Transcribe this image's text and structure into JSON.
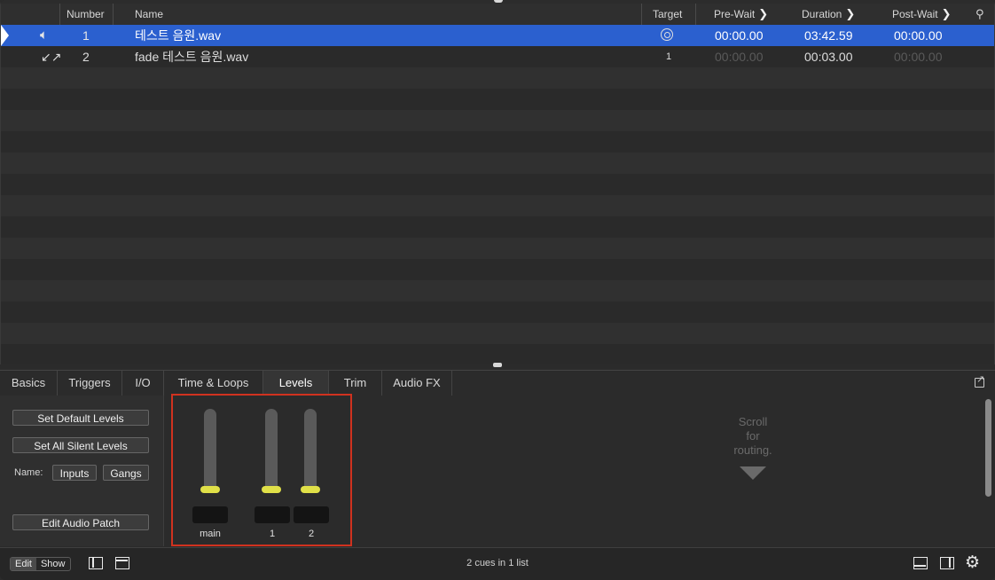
{
  "cuelist": {
    "headers": {
      "number": "Number",
      "name": "Name",
      "target": "Target",
      "prewait": "Pre-Wait",
      "duration": "Duration",
      "postwait": "Post-Wait"
    },
    "rows": [
      {
        "type": "audio",
        "number": "1",
        "name": "테스트 음원.wav",
        "target": "",
        "prewait": "00:00.00",
        "duration": "03:42.59",
        "postwait": "00:00.00",
        "selected": true
      },
      {
        "type": "fade",
        "number": "2",
        "name": "fade 테스트 음원.wav",
        "target": "1",
        "prewait": "00:00.00",
        "duration": "00:03.00",
        "postwait": "00:00.00",
        "selected": false
      }
    ]
  },
  "inspector": {
    "tabs": [
      "Basics",
      "Triggers",
      "I/O",
      "Time & Loops",
      "Levels",
      "Trim",
      "Audio FX"
    ],
    "active_tab": "Levels",
    "buttons": {
      "set_default": "Set Default Levels",
      "set_silent": "Set All Silent Levels",
      "name_label": "Name:",
      "inputs": "Inputs",
      "gangs": "Gangs",
      "edit_patch": "Edit Audio Patch"
    },
    "faders": [
      {
        "label": "main"
      },
      {
        "label": "1"
      },
      {
        "label": "2"
      }
    ],
    "scroll_hint_lines": [
      "Scroll",
      "for",
      "routing."
    ]
  },
  "statusbar": {
    "edit": "Edit",
    "show": "Show",
    "mode": "Edit",
    "summary": "2 cues in 1 list"
  },
  "colors": {
    "selection": "#2b60cf",
    "fader_knob": "#e0e048",
    "highlight": "#d0321f"
  }
}
